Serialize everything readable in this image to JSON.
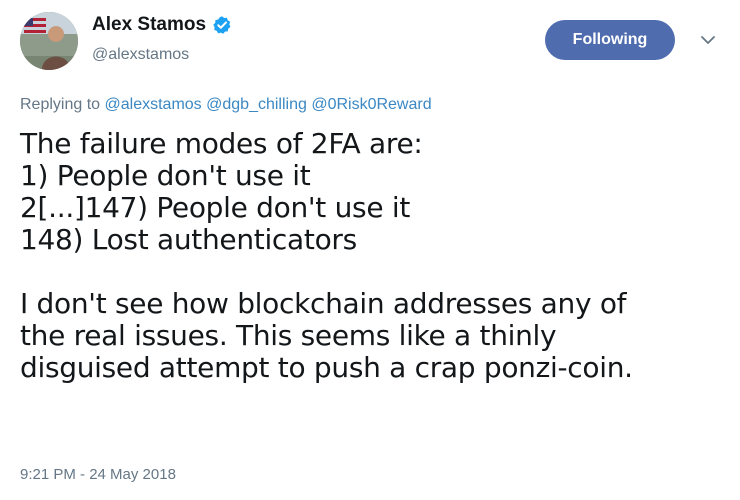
{
  "author": {
    "display_name": "Alex Stamos",
    "handle": "@alexstamos",
    "verified": true,
    "avatar_icon": "profile-photo"
  },
  "follow_button": {
    "label": "Following",
    "color": "#4f6cae"
  },
  "menu_icon": "chevron-down-icon",
  "reply": {
    "prefix": "Replying to",
    "mentions": [
      "@alexstamos",
      "@dgb_chilling",
      "@0Risk0Reward"
    ]
  },
  "tweet": {
    "lines": [
      "The failure modes of 2FA are:",
      "1) People don't use it",
      "2[...]147) People don't use it",
      "148) Lost authenticators",
      "",
      "I don't see how blockchain addresses any of",
      "the real issues. This seems like a thinly",
      "disguised attempt to push a crap ponzi-coin."
    ]
  },
  "timestamp": "9:21 PM - 24 May 2018",
  "colors": {
    "text": "#14171a",
    "secondary": "#657786",
    "link": "#3b88c3",
    "verified": "#1da1f2"
  }
}
